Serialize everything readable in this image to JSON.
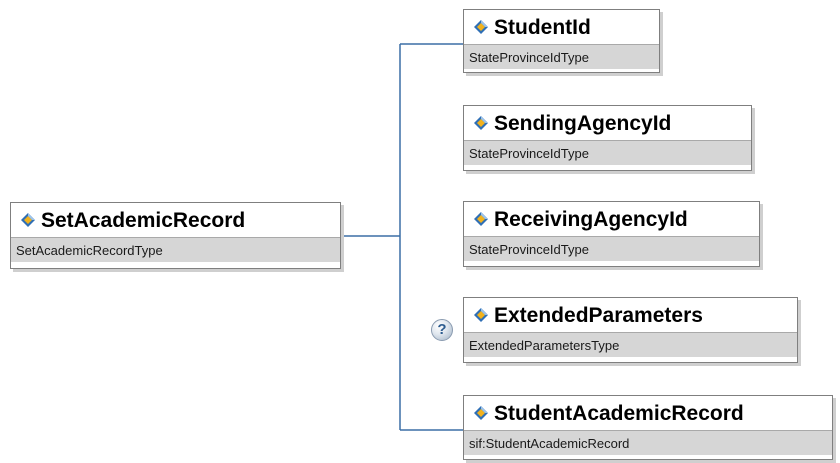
{
  "root": {
    "name": "SetAcademicRecord",
    "type": "SetAcademicRecordType"
  },
  "children": [
    {
      "name": "StudentId",
      "type": "StateProvinceIdType",
      "optional": false
    },
    {
      "name": "SendingAgencyId",
      "type": "StateProvinceIdType",
      "optional": false
    },
    {
      "name": "ReceivingAgencyId",
      "type": "StateProvinceIdType",
      "optional": false
    },
    {
      "name": "ExtendedParameters",
      "type": "ExtendedParametersType",
      "optional": true,
      "badge": "?"
    },
    {
      "name": "StudentAcademicRecord",
      "type": "sif:StudentAcademicRecord",
      "optional": false
    }
  ],
  "icons": {
    "element": "element-diamond-icon",
    "optional": "optional-question-icon"
  },
  "colors": {
    "connector": "#3b6ea5",
    "type_band": "#d6d6d6",
    "icon_blue": "#2f6fb5",
    "icon_gold": "#f2b21d"
  }
}
